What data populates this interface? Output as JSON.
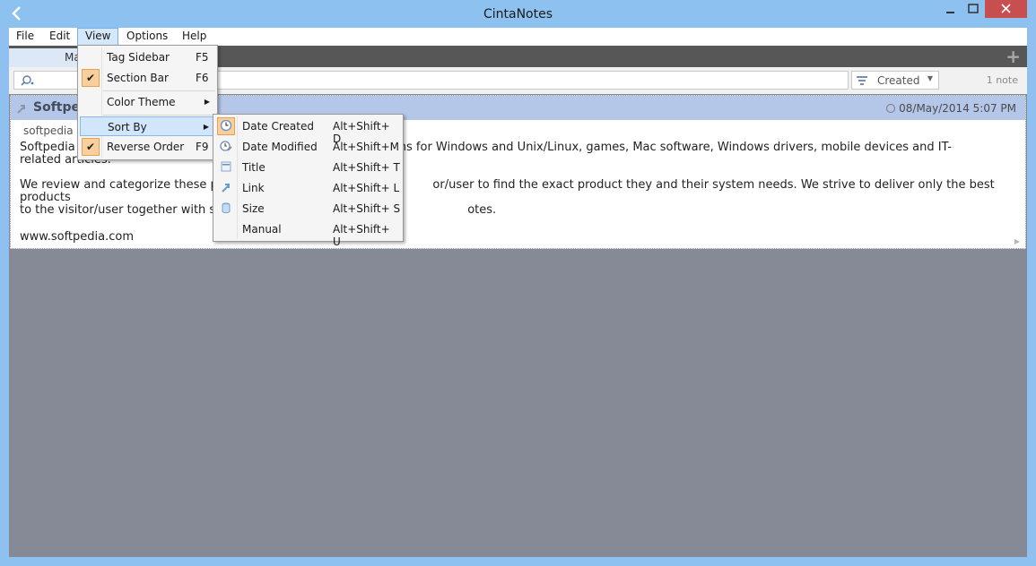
{
  "window": {
    "title": "CintaNotes"
  },
  "menubar": {
    "items": [
      "File",
      "Edit",
      "View",
      "Options",
      "Help"
    ]
  },
  "tabs": {
    "main_partial": "Ma"
  },
  "toolbar": {
    "sort_label": "Created",
    "count": "1 note"
  },
  "note": {
    "title_partial": "Softped",
    "date": "08/May/2014 5:07 PM",
    "tag": "softpedia",
    "body": [
      "Softpedia                                                                         e programs for Windows and Unix/Linux, games, Mac software, Windows drivers, mobile devices and IT-\nrelated articles.",
      "We review and categorize these p                                                          or/user to find the exact product they and their system needs. We strive to deliver only the best products\nto the visitor/user together with s                                                                    otes."
    ],
    "link": "www.softpedia.com"
  },
  "view_menu": {
    "items": [
      {
        "label": "Tag Sidebar",
        "key": "F5",
        "checked": false
      },
      {
        "label": "Section Bar",
        "key": "F6",
        "checked": true
      },
      {
        "label": "Color Theme",
        "key": "",
        "submenu": true
      },
      {
        "label": "Sort By",
        "key": "",
        "submenu": true,
        "highlighted": true
      },
      {
        "label": "Reverse Order",
        "key": "F9",
        "checked": true
      }
    ]
  },
  "sort_menu": {
    "items": [
      {
        "label": "Date Created",
        "key": "Alt+Shift+ D",
        "icon": "clock-icon",
        "selected": true
      },
      {
        "label": "Date Modified",
        "key": "Alt+Shift+M",
        "icon": "clock-edit-icon"
      },
      {
        "label": "Title",
        "key": "Alt+Shift+ T",
        "icon": "title-icon"
      },
      {
        "label": "Link",
        "key": "Alt+Shift+ L",
        "icon": "link-icon"
      },
      {
        "label": "Size",
        "key": "Alt+Shift+ S",
        "icon": "size-icon"
      },
      {
        "label": "Manual",
        "key": "Alt+Shift+ U",
        "icon": ""
      }
    ]
  },
  "colors": {
    "accent": "#8cc1f0",
    "note_header": "#b4c7e8",
    "check": "#f9cf9c"
  }
}
